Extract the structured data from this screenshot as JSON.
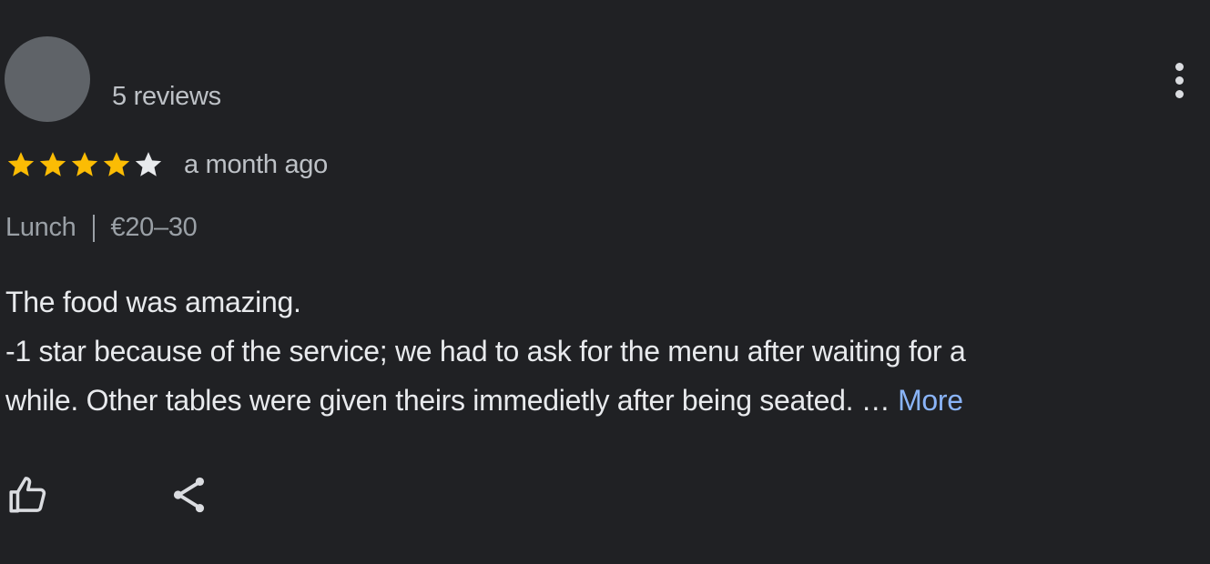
{
  "reviewer": {
    "avatar_color": "#5f6368",
    "review_count": "5 reviews"
  },
  "menu": {
    "icon": "more-vert-icon"
  },
  "rating": {
    "value": 4,
    "max": 5,
    "filled_color": "#fbbc04",
    "empty_color": "#e8eaed",
    "time_ago": "a month ago"
  },
  "meta": {
    "meal": "Lunch",
    "price": "€20–30"
  },
  "body": {
    "line1": "The food was amazing.",
    "line2": "-1 star because of the service; we had to ask for the menu after waiting for a",
    "line3": "while. Other tables were given theirs immedietly after being seated. …",
    "more_label": "More"
  },
  "actions": {
    "like_icon": "thumbs-up-icon",
    "share_icon": "share-icon"
  },
  "colors": {
    "background": "#202124",
    "link": "#8ab4f8"
  }
}
